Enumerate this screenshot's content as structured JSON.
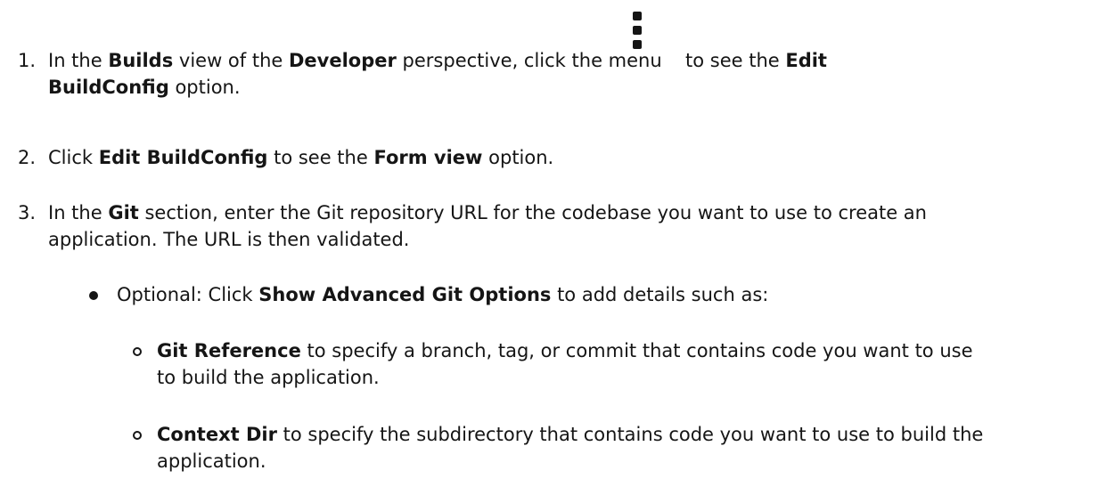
{
  "steps": [
    {
      "number": "1.",
      "prefix": "In the ",
      "b1": "Builds",
      "mid1": " view of the ",
      "b2": "Developer",
      "mid2": " perspective, click the menu",
      "after_icon": "to see the ",
      "b3": "Edit",
      "b3_cont": "BuildConfig",
      "suffix": " option.",
      "icon": "kebab-menu-icon"
    },
    {
      "number": "2.",
      "prefix": "Click ",
      "b1": "Edit BuildConfig",
      "mid1": " to see the ",
      "b2": "Form view",
      "suffix": " option."
    },
    {
      "number": "3.",
      "prefix": "In the ",
      "b1": "Git",
      "line1_rest": " section, enter the Git repository URL for the codebase you want to use to create an",
      "line2": "application. The URL is then validated."
    }
  ],
  "bullet": {
    "prefix": "Optional: Click ",
    "bold": "Show Advanced Git Options",
    "suffix": " to add details such as:"
  },
  "subitems": [
    {
      "bold": "Git Reference",
      "line1_rest": " to specify a branch, tag, or commit that contains code you want to use",
      "line2": "to build the application."
    },
    {
      "bold": "Context Dir",
      "line1_rest": " to specify the subdirectory that contains code you want to use to build the",
      "line2": "application."
    }
  ]
}
